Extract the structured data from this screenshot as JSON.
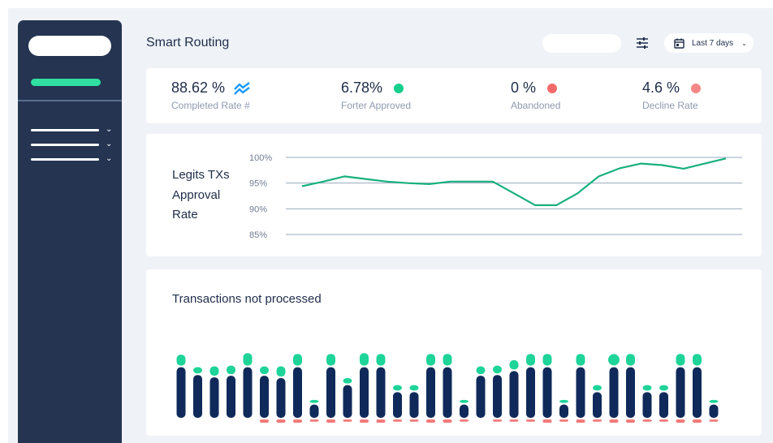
{
  "header": {
    "title": "Smart Routing",
    "date_range": "Last 7 days"
  },
  "stats": [
    {
      "value": "88.62 %",
      "label": "Completed Rate #",
      "marker": "trend-icon",
      "color": "#1e9bff"
    },
    {
      "value": "6.78%",
      "label": "Forter Approved",
      "marker": "dot",
      "color": "#17cf8c"
    },
    {
      "value": "0 %",
      "label": "Abandoned",
      "marker": "dot",
      "color": "#f46a6a"
    },
    {
      "value": "4.6 %",
      "label": "Decline Rate",
      "marker": "dot",
      "color": "#f58787"
    }
  ],
  "colors": {
    "sidebar": "#243451",
    "accent": "#2fe0a0",
    "navy": "#0f2a5a",
    "green": "#1ed498",
    "red": "#f27a7a",
    "line": "#17b07c"
  },
  "chart_data": [
    {
      "type": "line",
      "title": "Legits TXs Approval Rate",
      "title_lines": [
        "Legits TXs",
        "Approval",
        "Rate"
      ],
      "y_ticks": [
        100,
        95,
        90,
        85
      ],
      "y_tick_labels": [
        "100%",
        "95%",
        "90%",
        "85%"
      ],
      "ylim": [
        85,
        100
      ],
      "grid": true,
      "values": [
        94.4,
        95.3,
        96.3,
        95.8,
        95.3,
        95.0,
        94.8,
        95.3,
        95.3,
        95.3,
        93.0,
        90.7,
        90.7,
        93.0,
        96.3,
        97.9,
        98.8,
        98.5,
        97.8,
        98.8,
        99.8
      ]
    },
    {
      "type": "bar",
      "title": "Transactions not processed",
      "stacked": true,
      "axes_shown": false,
      "series": [
        {
          "values": [
            6.5,
            5.5,
            5.2,
            5.4,
            6.5,
            5.4,
            5.1,
            6.5,
            1.7,
            6.5,
            4.2,
            6.5,
            6.5,
            3.3,
            3.3,
            6.5,
            6.5,
            1.7,
            5.4,
            5.5,
            6.0,
            6.5,
            6.5,
            1.7,
            6.5,
            3.3,
            6.5,
            6.5,
            3.3,
            3.3,
            6.5,
            6.5,
            1.7
          ]
        },
        {
          "values": [
            1.4,
            0.8,
            1.2,
            1.1,
            1.6,
            1.0,
            1.3,
            1.5,
            0.4,
            1.5,
            0.7,
            1.6,
            1.5,
            0.7,
            0.7,
            1.5,
            1.5,
            0.4,
            1.0,
            1.0,
            1.2,
            1.5,
            1.5,
            0.4,
            1.5,
            0.7,
            1.5,
            1.5,
            0.7,
            0.7,
            1.5,
            1.5,
            0.4
          ]
        },
        {
          "values": [
            0,
            0,
            0,
            0,
            0,
            0.3,
            0.3,
            0.3,
            0.2,
            0.3,
            0.2,
            0.3,
            0.3,
            0.2,
            0.2,
            0.3,
            0.3,
            0.2,
            0,
            0.2,
            0.2,
            0.2,
            0.3,
            0.2,
            0.3,
            0.2,
            0.3,
            0.3,
            0.2,
            0.2,
            0.3,
            0.3,
            0.2
          ]
        }
      ]
    }
  ]
}
